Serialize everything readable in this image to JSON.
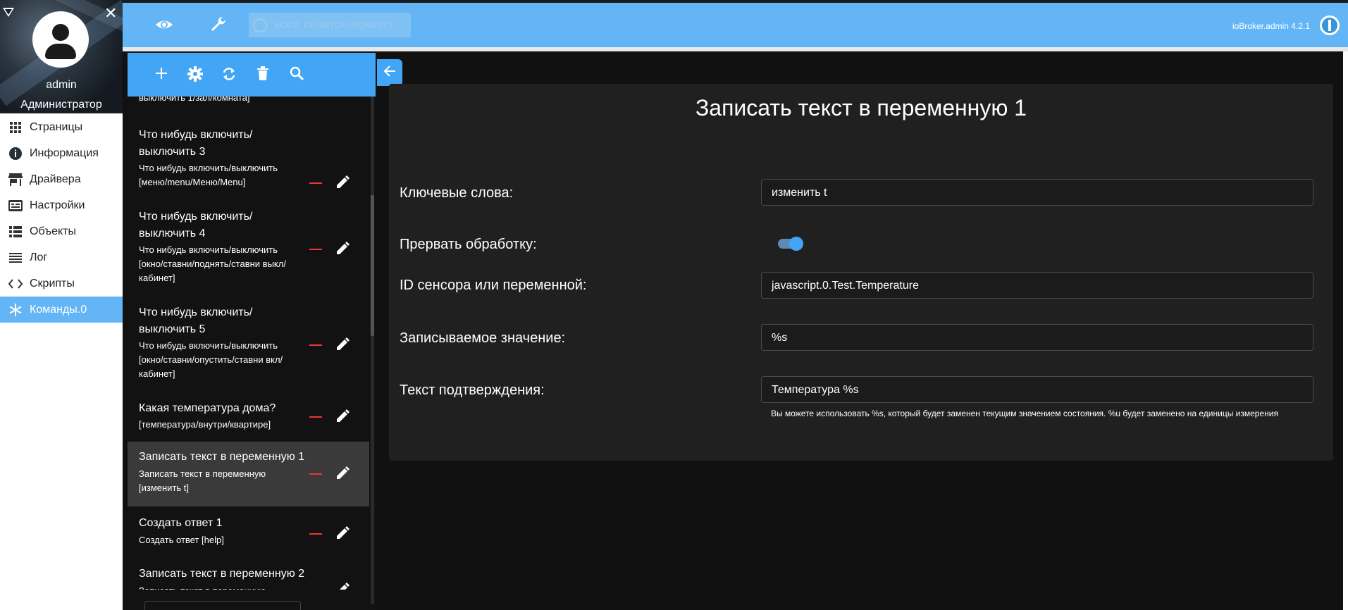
{
  "user": {
    "name": "admin",
    "role": "Администратор"
  },
  "nav": {
    "items": [
      {
        "label": "Страницы",
        "icon": "grid-icon"
      },
      {
        "label": "Информация",
        "icon": "info-icon"
      },
      {
        "label": "Драйвера",
        "icon": "store-icon"
      },
      {
        "label": "Настройки",
        "icon": "settings-panel-icon"
      },
      {
        "label": "Объекты",
        "icon": "list-icon"
      },
      {
        "label": "Лог",
        "icon": "lines-icon"
      },
      {
        "label": "Скрипты",
        "icon": "code-icon"
      },
      {
        "label": "Команды.0",
        "icon": "snowflake-icon",
        "active": true
      }
    ]
  },
  "header": {
    "host": "ХОСТ: DESKTOP-RQ6NVT3",
    "version": "ioBroker.admin 4.2.1"
  },
  "commands": {
    "partial_top": "выключить 1/зал/комната]",
    "items": [
      {
        "title": "Что нибудь включить/ выключить 3",
        "sub": "Что нибудь включить/выключить [меню/menu/Меню/Menu]"
      },
      {
        "title": "Что нибудь включить/ выключить 4",
        "sub": "Что нибудь включить/выключить [окно/ставни/поднять/ставни выкл/кабинет]"
      },
      {
        "title": "Что нибудь включить/ выключить 5",
        "sub": "Что нибудь включить/выключить [окно/ставни/опустить/ставни вкл/кабинет]"
      },
      {
        "title": "Какая температура дома?",
        "sub": "[температура/внутри/квартире]"
      },
      {
        "title": "Записать текст в переменную 1",
        "sub": "Записать текст в переменную [изменить t]",
        "selected": true
      },
      {
        "title": "Создать ответ 1",
        "sub": "Создать ответ [help]"
      },
      {
        "title": "Записать текст в переменную 2",
        "sub": "Записать текст в переменную"
      }
    ]
  },
  "detail": {
    "title": "Записать текст в переменную 1",
    "fields": {
      "keywords_label": "Ключевые слова:",
      "keywords_value": "изменить t",
      "break_label": "Прервать обработку:",
      "break_on": true,
      "sensor_label": "ID сенсора или переменной:",
      "sensor_value": "javascript.0.Test.Temperature",
      "value_label": "Записываемое значение:",
      "value_value": "%s",
      "confirm_label": "Текст подтверждения:",
      "confirm_value": "Температура %s",
      "help": "Вы можете использовать %s, который будет заменен текущим значением состояния. %u будет заменено на единицы измерения"
    }
  },
  "colors": {
    "accent": "#42a5f5",
    "header": "#64b5f6",
    "delete": "#e53935"
  }
}
